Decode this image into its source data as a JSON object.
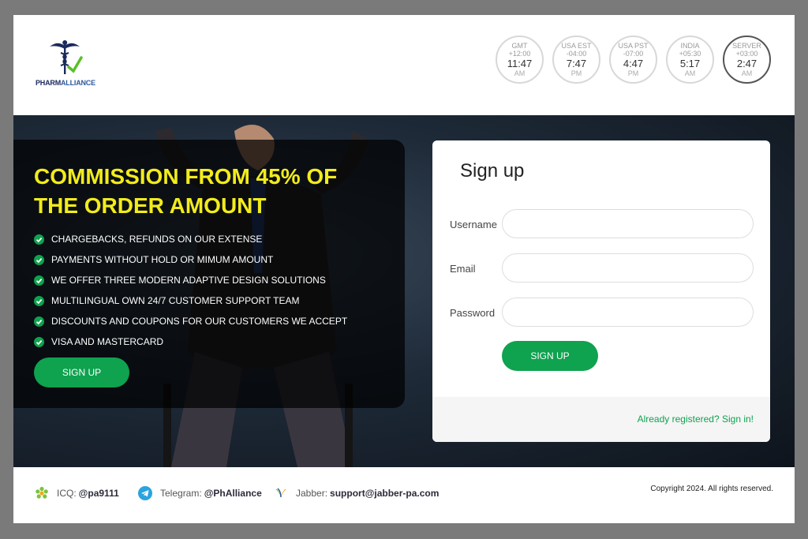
{
  "brand": {
    "name_part1": "PHARM",
    "name_part2": "ALLIANCE"
  },
  "clocks": [
    {
      "zone": "GMT",
      "offset": "+12:00",
      "time": "11:47",
      "ampm": "AM"
    },
    {
      "zone": "USA EST",
      "offset": "-04:00",
      "time": "7:47",
      "ampm": "PM"
    },
    {
      "zone": "USA PST",
      "offset": "-07:00",
      "time": "4:47",
      "ampm": "PM"
    },
    {
      "zone": "INDIA",
      "offset": "+05:30",
      "time": "5:17",
      "ampm": "AM"
    },
    {
      "zone": "SERVER",
      "offset": "+03:00",
      "time": "2:47",
      "ampm": "AM"
    }
  ],
  "promo": {
    "headline": "COMMISSION FROM 45% OF THE ORDER AMOUNT",
    "benefits": [
      "CHARGEBACKS, REFUNDS ON OUR EXTENSE",
      "PAYMENTS WITHOUT HOLD OR MIMUM AMOUNT",
      "WE OFFER THREE MODERN ADAPTIVE DESIGN SOLUTIONS",
      "MULTILINGUAL OWN 24/7 CUSTOMER SUPPORT TEAM",
      "DISCOUNTS AND COUPONS FOR OUR CUSTOMERS WE ACCEPT",
      "VISA AND MASTERCARD"
    ],
    "button_label": "SIGN UP"
  },
  "signup": {
    "title": "Sign up",
    "username_label": "Username",
    "email_label": "Email",
    "password_label": "Password",
    "username_value": "",
    "email_value": "",
    "password_value": "",
    "button_label": "SIGN UP",
    "signin_link": "Already registered? Sign in!"
  },
  "footer": {
    "icq_label": "ICQ:",
    "icq_value": "@pa9111",
    "telegram_label": "Telegram:",
    "telegram_value": "@PhAlliance",
    "jabber_label": "Jabber:",
    "jabber_value": "support@jabber-pa.com",
    "copyright": "Copyright 2024. All rights reserved."
  },
  "colors": {
    "accent": "#0fa24f",
    "headline": "#f2ec1b",
    "brand": "#1b2a5c"
  }
}
